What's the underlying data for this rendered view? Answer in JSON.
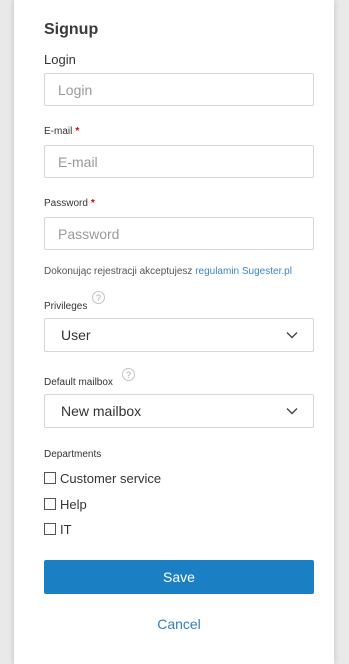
{
  "form": {
    "title": "Signup",
    "login": {
      "label": "Login",
      "placeholder": "Login",
      "value": ""
    },
    "email": {
      "label": "E-mail",
      "required_mark": "*",
      "placeholder": "E-mail",
      "value": ""
    },
    "password": {
      "label": "Password",
      "required_mark": "*",
      "placeholder": "Password",
      "value": ""
    },
    "terms": {
      "text": "Dokonując rejestracji akceptujesz ",
      "link": "regulamin Sugester.pl"
    },
    "privileges": {
      "label": "Privileges",
      "help": "?",
      "selected": "User"
    },
    "mailbox": {
      "label": "Default mailbox",
      "help": "?",
      "selected": "New mailbox"
    },
    "departments": {
      "label": "Departments",
      "items": [
        {
          "label": "Customer service",
          "checked": false
        },
        {
          "label": "Help",
          "checked": false
        },
        {
          "label": "IT",
          "checked": false
        }
      ]
    },
    "save_label": "Save",
    "cancel_label": "Cancel"
  },
  "colors": {
    "accent": "#1b80c3",
    "link": "#3b86c4",
    "required": "#d0021b",
    "background": "#e9e9e9"
  }
}
